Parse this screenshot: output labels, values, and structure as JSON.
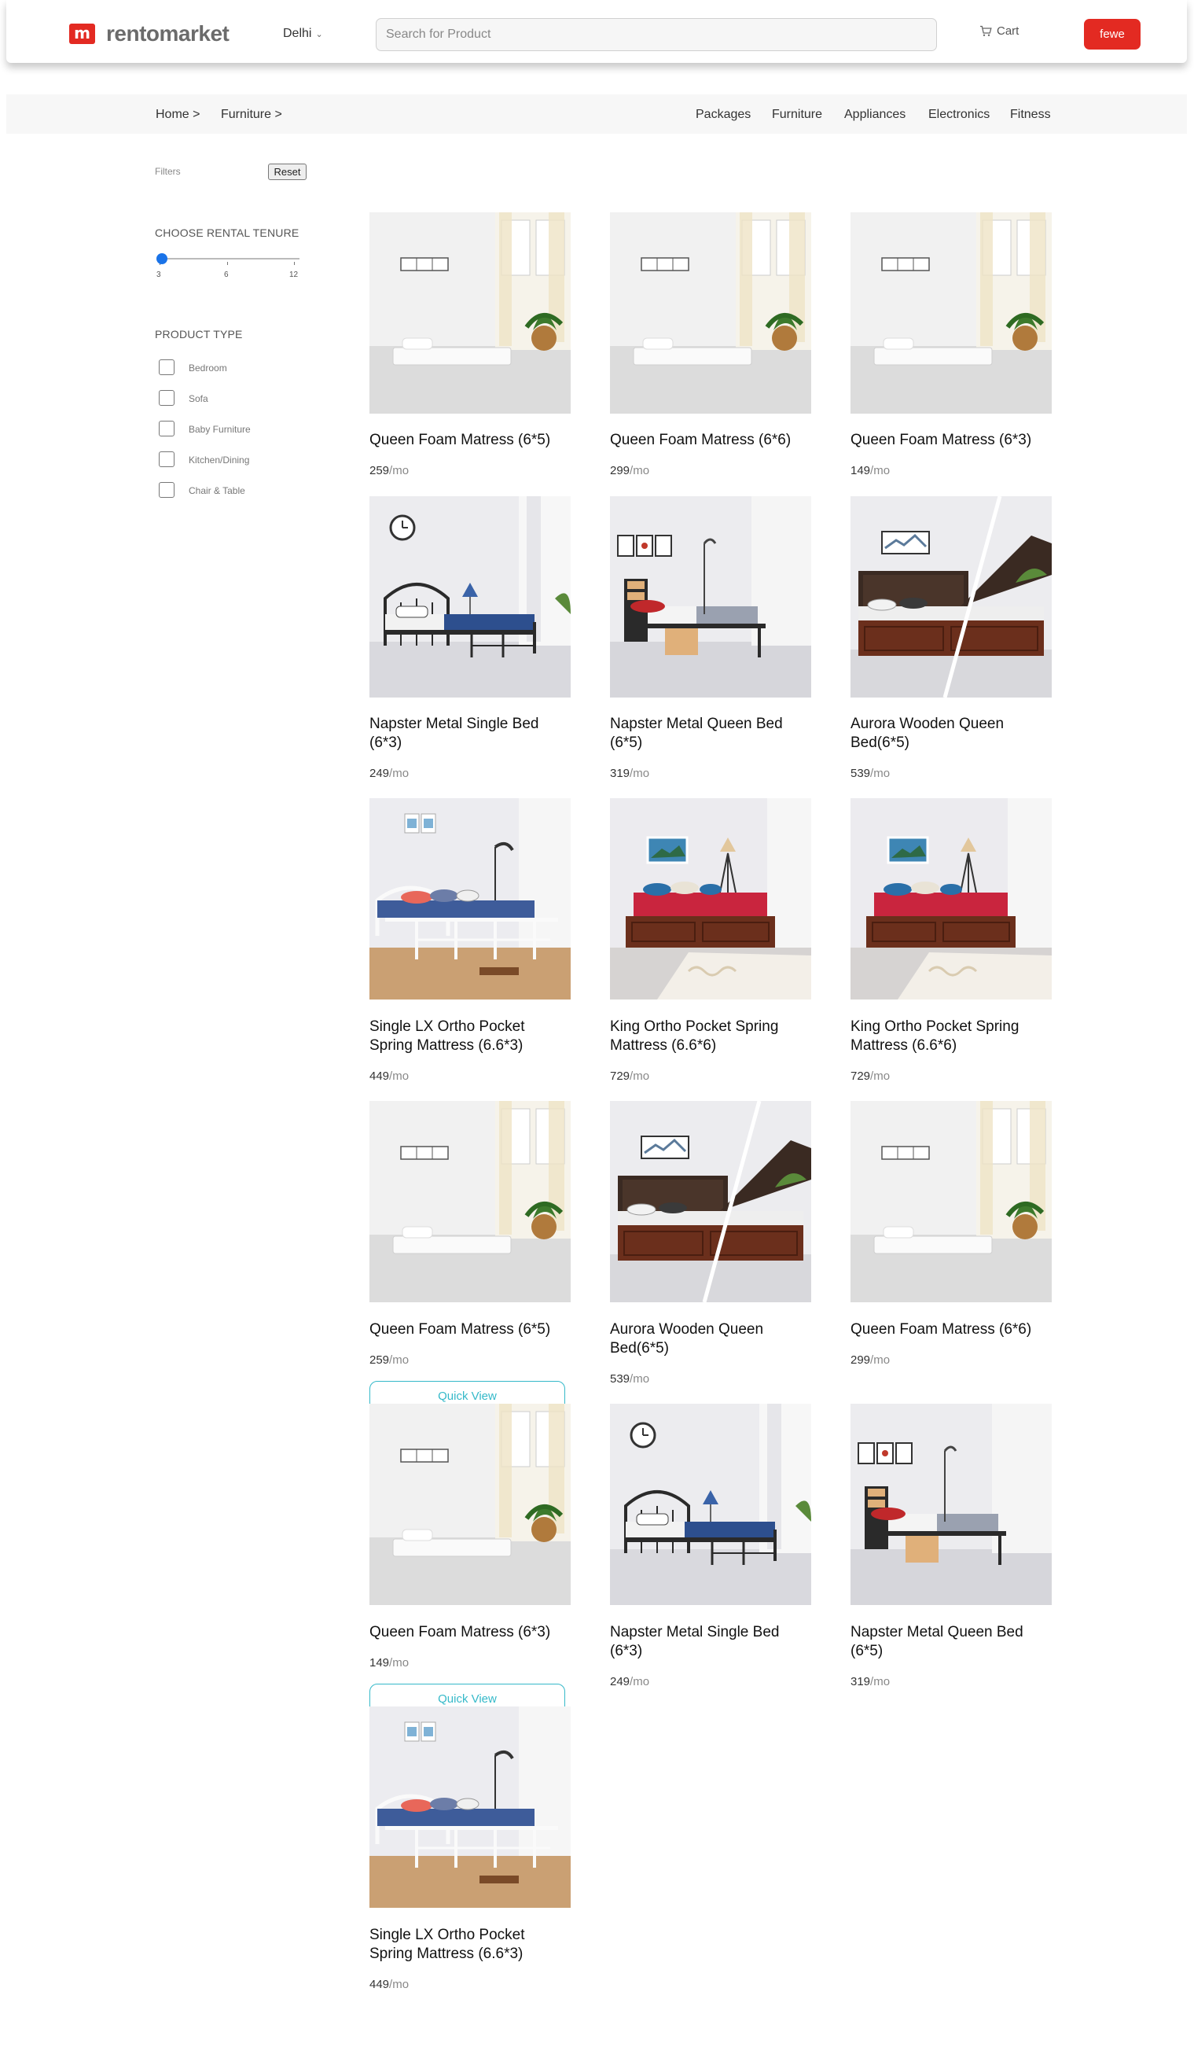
{
  "header": {
    "logo_mark": "m",
    "logo_text": "rentomarket",
    "city": "Delhi",
    "search_placeholder": "Search for Product",
    "cart_label": "Cart",
    "user_label": "fewe"
  },
  "colors": {
    "brand_red": "#e32a22",
    "slider_blue": "#1a73e8",
    "quick_view_teal": "#35b9c9"
  },
  "breadcrumb": [
    "Home >",
    "Furniture >"
  ],
  "nav_links": [
    "Packages",
    "Furniture",
    "Appliances",
    "Electronics",
    "Fitness"
  ],
  "sidebar": {
    "filters_label": "Filters",
    "reset_label": "Reset",
    "tenure_heading": "CHOOSE RENTAL TENURE",
    "tenure_ticks": [
      "3",
      "6",
      "12"
    ],
    "tenure_selected": "3",
    "product_type_heading": "PRODUCT TYPE",
    "product_types": [
      "Bedroom",
      "Sofa",
      "Baby Furniture",
      "Kitchen/Dining",
      "Chair & Table"
    ]
  },
  "quick_view_label": "Quick View",
  "price_suffix": "/mo",
  "products": [
    {
      "title": "Queen Foam Matress (6*5)",
      "price": "259",
      "image": "foam-mattress"
    },
    {
      "title": "Queen Foam Matress (6*6)",
      "price": "299",
      "image": "foam-mattress"
    },
    {
      "title": "Queen Foam Matress (6*3)",
      "price": "149",
      "image": "foam-mattress"
    },
    {
      "title": "Napster Metal Single Bed (6*3)",
      "price": "249",
      "image": "metal-bed-clock"
    },
    {
      "title": "Napster Metal Queen Bed (6*5)",
      "price": "319",
      "image": "metal-bed-red"
    },
    {
      "title": "Aurora Wooden Queen Bed(6*5)",
      "price": "539",
      "image": "wooden-storage-bed"
    },
    {
      "title": "Single LX Ortho Pocket Spring Mattress (6.6*3)",
      "price": "449",
      "image": "white-metal-bed"
    },
    {
      "title": "King Ortho Pocket Spring Mattress (6.6*6)",
      "price": "729",
      "image": "king-red-bed"
    },
    {
      "title": "King Ortho Pocket Spring Mattress (6.6*6)",
      "price": "729",
      "image": "king-red-bed"
    },
    {
      "title": "Queen Foam Matress (6*5)",
      "price": "259",
      "image": "foam-mattress"
    },
    {
      "title": "Aurora Wooden Queen Bed(6*5)",
      "price": "539",
      "image": "wooden-storage-bed"
    },
    {
      "title": "Queen Foam Matress (6*6)",
      "price": "299",
      "image": "foam-mattress"
    },
    {
      "title": "Queen Foam Matress (6*3)",
      "price": "149",
      "image": "foam-mattress"
    },
    {
      "title": "Napster Metal Single Bed (6*3)",
      "price": "249",
      "image": "metal-bed-clock"
    },
    {
      "title": "Napster Metal Queen Bed (6*5)",
      "price": "319",
      "image": "metal-bed-red"
    },
    {
      "title": "Single LX Ortho Pocket Spring Mattress (6.6*3)",
      "price": "449",
      "image": "white-metal-bed"
    }
  ]
}
